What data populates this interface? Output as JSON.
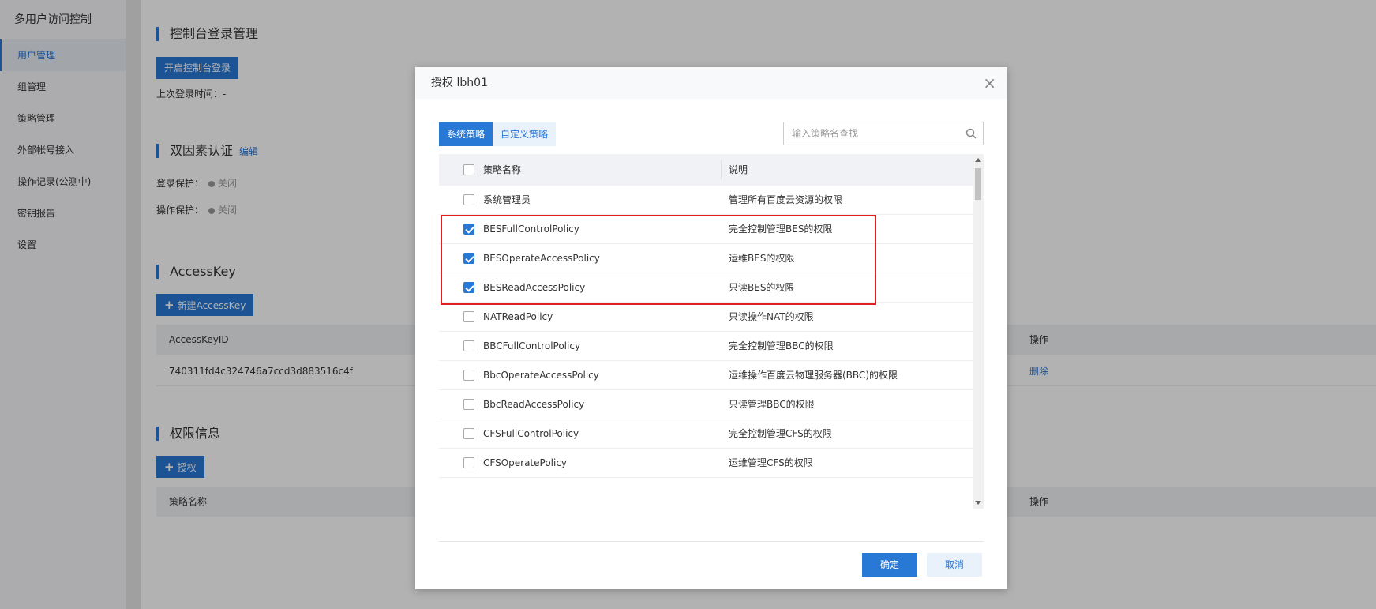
{
  "sidebar": {
    "title": "多用户访问控制",
    "items": [
      {
        "label": "用户管理",
        "active": true
      },
      {
        "label": "组管理"
      },
      {
        "label": "策略管理"
      },
      {
        "label": "外部帐号接入"
      },
      {
        "label": "操作记录(公测中)"
      },
      {
        "label": "密钥报告"
      },
      {
        "label": "设置"
      }
    ]
  },
  "console_login": {
    "title": "控制台登录管理",
    "button": "开启控制台登录",
    "last_login": "上次登录时间：-"
  },
  "mfa": {
    "title": "双因素认证",
    "edit": "编辑",
    "login_protect_label": "登录保护：",
    "op_protect_label": "操作保护：",
    "status_off": "关闭"
  },
  "accesskey": {
    "title": "AccessKey",
    "new_button": "新建AccessKey",
    "col_id": "AccessKeyID",
    "col_action": "操作",
    "row_id": "740311fd4c324746a7ccd3d883516c4f",
    "row_action": "删除"
  },
  "permissions": {
    "title": "权限信息",
    "grant_button": "授权",
    "col_name": "策略名称",
    "col_action": "操作"
  },
  "modal": {
    "title": "授权 lbh01",
    "close": "×",
    "tabs": [
      {
        "label": "系统策略",
        "active": true
      },
      {
        "label": "自定义策略"
      }
    ],
    "search_placeholder": "输入策略名查找",
    "table": {
      "col_name": "策略名称",
      "col_desc": "说明",
      "rows": [
        {
          "name": "系统管理员",
          "desc": "管理所有百度云资源的权限",
          "checked": false
        },
        {
          "name": "BESFullControlPolicy",
          "desc": "完全控制管理BES的权限",
          "checked": true
        },
        {
          "name": "BESOperateAccessPolicy",
          "desc": "运维BES的权限",
          "checked": true
        },
        {
          "name": "BESReadAccessPolicy",
          "desc": "只读BES的权限",
          "checked": true
        },
        {
          "name": "NATReadPolicy",
          "desc": "只读操作NAT的权限",
          "checked": false
        },
        {
          "name": "BBCFullControlPolicy",
          "desc": "完全控制管理BBC的权限",
          "checked": false
        },
        {
          "name": "BbcOperateAccessPolicy",
          "desc": "运维操作百度云物理服务器(BBC)的权限",
          "checked": false
        },
        {
          "name": "BbcReadAccessPolicy",
          "desc": "只读管理BBC的权限",
          "checked": false
        },
        {
          "name": "CFSFullControlPolicy",
          "desc": "完全控制管理CFS的权限",
          "checked": false
        },
        {
          "name": "CFSOperatePolicy",
          "desc": "运维管理CFS的权限",
          "checked": false
        }
      ]
    },
    "ok": "确定",
    "cancel": "取消"
  },
  "colors": {
    "accent": "#2878d6",
    "highlight": "#e02020"
  }
}
